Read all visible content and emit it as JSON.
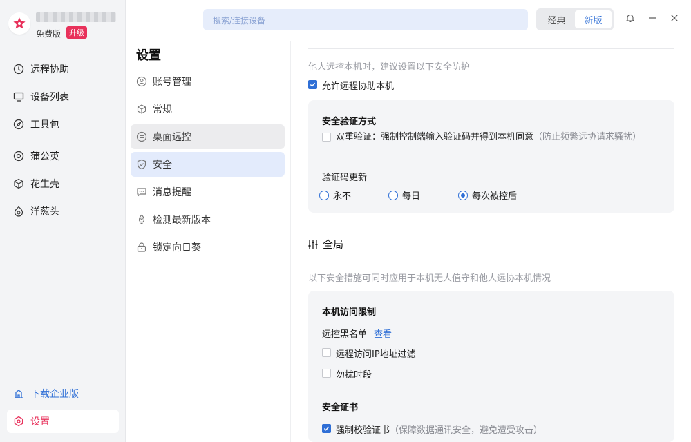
{
  "app": {
    "plan": "免费版",
    "upgrade": "升级",
    "colors": {
      "accent": "#2f6fd6",
      "brand": "#e8315b"
    }
  },
  "nav": {
    "items": [
      {
        "label": "远程协助",
        "icon": "remote-assist-icon"
      },
      {
        "label": "设备列表",
        "icon": "monitor-icon"
      },
      {
        "label": "工具包",
        "icon": "compass-icon"
      },
      {
        "label": "蒲公英",
        "icon": "dandelion-icon"
      },
      {
        "label": "花生壳",
        "icon": "cube-icon"
      },
      {
        "label": "洋葱头",
        "icon": "onion-icon"
      }
    ],
    "download": "下载企业版",
    "settings": "设置"
  },
  "topbar": {
    "search_placeholder": "搜索/连接设备",
    "mode_classic": "经典",
    "mode_new": "新版"
  },
  "settings_menu": {
    "title": "设置",
    "items": [
      {
        "label": "账号管理",
        "icon": "account-icon"
      },
      {
        "label": "常规",
        "icon": "cube-outline-icon"
      },
      {
        "label": "桌面远控",
        "icon": "remote-desktop-icon"
      },
      {
        "label": "安全",
        "icon": "shield-icon"
      },
      {
        "label": "消息提醒",
        "icon": "message-icon"
      },
      {
        "label": "检测最新版本",
        "icon": "rocket-icon"
      },
      {
        "label": "锁定向日葵",
        "icon": "lock-icon"
      }
    ]
  },
  "content": {
    "remote_hint": "他人远控本机时，建议设置以下安全防护",
    "allow_remote": {
      "label": "允许远程协助本机",
      "checked": true
    },
    "verify_card": {
      "title": "安全验证方式",
      "dual_verify": {
        "label": "双重验证：强制控制端输入验证码并得到本机同意",
        "note": "（防止频繁远协请求骚扰）",
        "checked": false
      },
      "code_update_label": "验证码更新",
      "options": [
        {
          "label": "永不",
          "selected": false
        },
        {
          "label": "每日",
          "selected": false
        },
        {
          "label": "每次被控后",
          "selected": true
        }
      ]
    },
    "global": {
      "title": "全局",
      "hint": "以下安全措施可同时应用于本机无人值守和他人远协本机情况",
      "access_card": {
        "title": "本机访问限制",
        "blacklist_label": "远控黑名单",
        "blacklist_link": "查看",
        "ip_filter": {
          "label": "远程访问IP地址过滤",
          "checked": false
        },
        "dnd": {
          "label": "勿扰时段",
          "checked": false
        },
        "cert_title": "安全证书",
        "force_cert": {
          "label": "强制校验证书",
          "note": "（保障数据通讯安全，避免遭受攻击）",
          "checked": true
        }
      }
    }
  }
}
